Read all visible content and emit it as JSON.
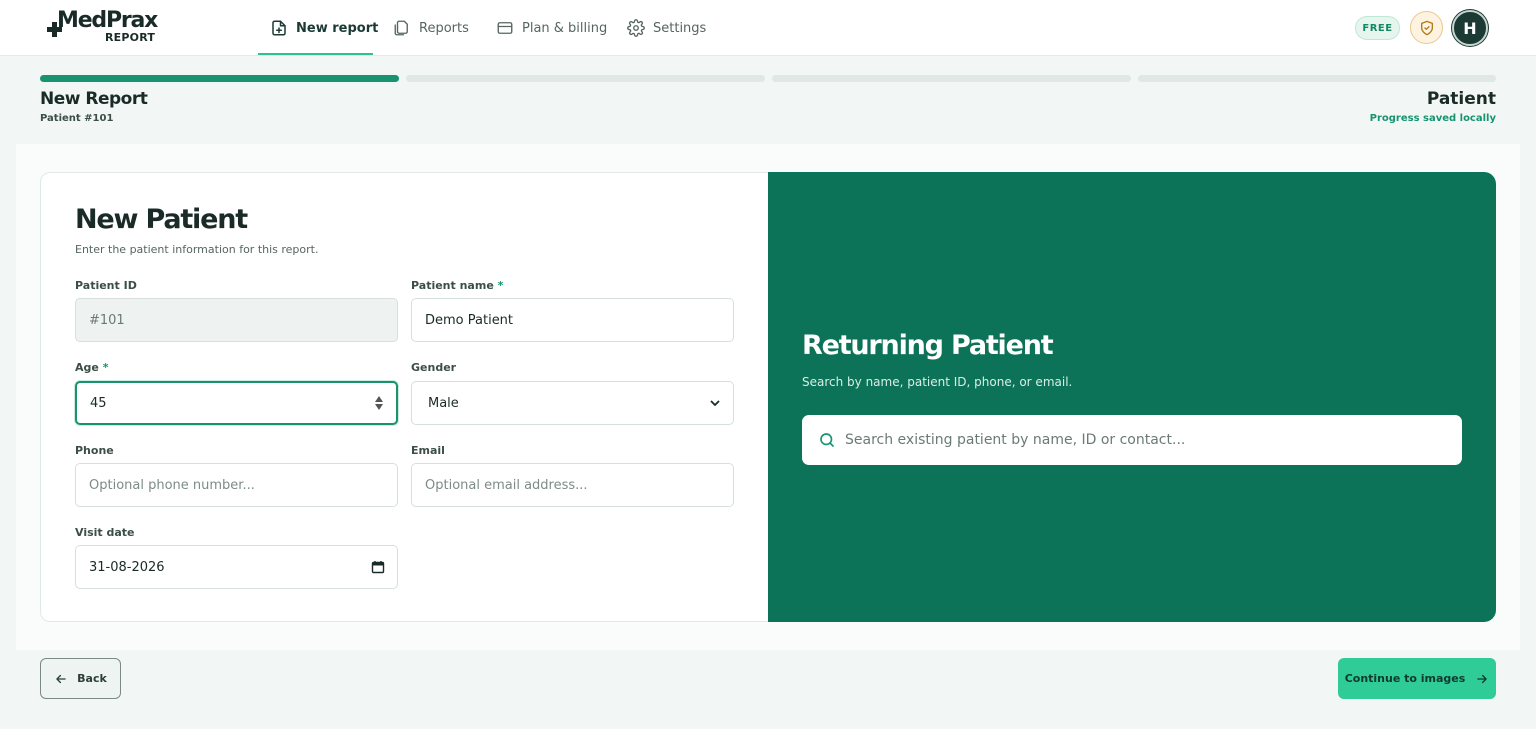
{
  "brand": {
    "name": "MedPrax",
    "sub": "REPORT"
  },
  "nav": {
    "items": [
      {
        "label": "New report",
        "icon": "file-plus-icon"
      },
      {
        "label": "Reports",
        "icon": "files-icon"
      },
      {
        "label": "Plan & billing",
        "icon": "credit-card-icon"
      },
      {
        "label": "Settings",
        "icon": "gear-icon"
      }
    ],
    "active": "New report"
  },
  "header_right": {
    "plan_badge": "FREE",
    "avatar_initial": "H",
    "shield_icon": "shield-check-icon"
  },
  "progress": {
    "total_steps": 4,
    "current_step": 1
  },
  "page_header": {
    "title": "New Report",
    "patient_ref": "Patient #101",
    "step_name": "Patient",
    "save_status": "Progress saved locally"
  },
  "form": {
    "title": "New Patient",
    "subtitle": "Enter the patient information for this report.",
    "patient_id": {
      "label": "Patient ID",
      "value": "#101"
    },
    "patient_name": {
      "label": "Patient name",
      "required_mark": "*",
      "value": "Demo Patient"
    },
    "age": {
      "label": "Age",
      "required_mark": "*",
      "value": "45"
    },
    "gender": {
      "label": "Gender",
      "value": "Male"
    },
    "phone": {
      "label": "Phone",
      "placeholder": "Optional phone number..."
    },
    "email": {
      "label": "Email",
      "placeholder": "Optional email address..."
    },
    "visit_date": {
      "label": "Visit date",
      "value": "31-08-2026"
    }
  },
  "returning": {
    "title": "Returning Patient",
    "subtitle": "Search by name, patient ID, phone, or email.",
    "search_placeholder": "Search existing patient by name, ID or contact..."
  },
  "footer": {
    "back_label": "Back",
    "continue_label": "Continue to images"
  },
  "colors": {
    "accent": "#17946f",
    "panel_green": "#0c7358",
    "cta": "#2fcc98"
  }
}
